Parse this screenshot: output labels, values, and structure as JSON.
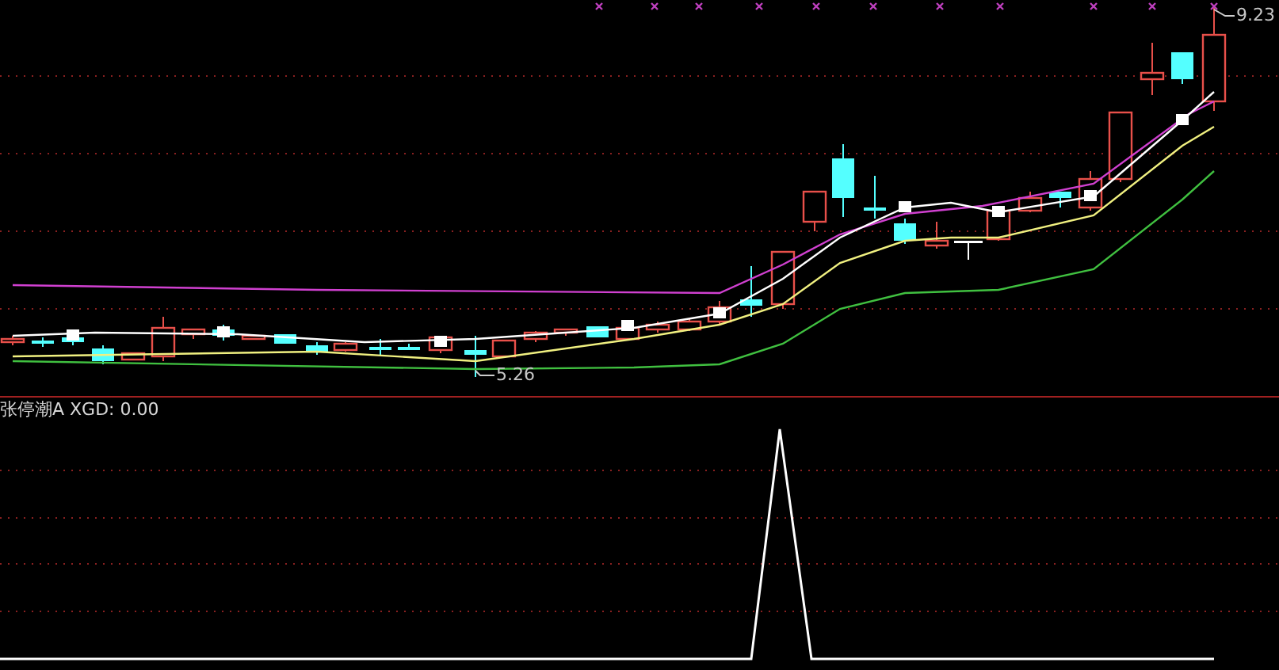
{
  "price_chart": {
    "high_label": "9.23",
    "low_label": "5.26"
  },
  "indicator": {
    "label": "张停潮A XGD: 0.00"
  }
}
